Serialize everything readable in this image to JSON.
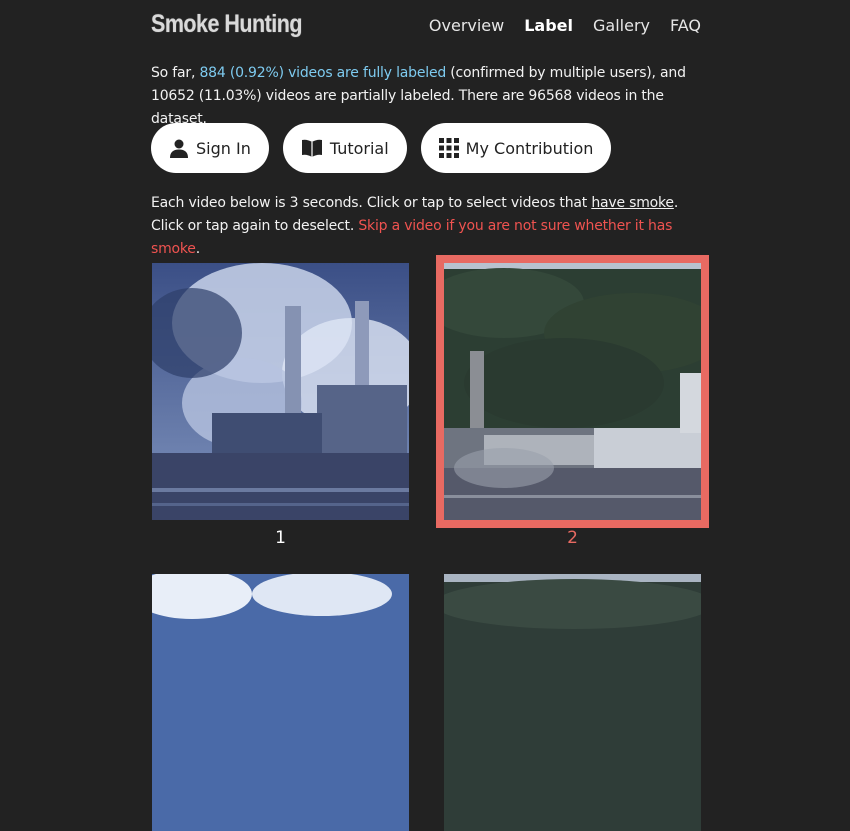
{
  "header": {
    "brand": "Smoke Hunting",
    "nav": [
      {
        "label": "Overview",
        "active": false
      },
      {
        "label": "Label",
        "active": true
      },
      {
        "label": "Gallery",
        "active": false
      },
      {
        "label": "FAQ",
        "active": false
      }
    ]
  },
  "stats": {
    "prefix": "So far, ",
    "fully_labeled": "884 (0.92%) videos are fully labeled",
    "middle": " (confirmed by multiple users), and 10652 (11.03%) videos are partially labeled. There are 96568 videos in the dataset."
  },
  "buttons": {
    "sign_in": "Sign In",
    "tutorial": "Tutorial",
    "my_contribution": "My Contribution"
  },
  "instructions": {
    "part1": "Each video below is 3 seconds. Click or tap to select videos that ",
    "underlined": "have smoke",
    "part2": ". Click or tap again to deselect. ",
    "warning": "Skip a video if you are not sure whether it has smoke",
    "end": "."
  },
  "videos": [
    {
      "number": "1",
      "selected": false
    },
    {
      "number": "2",
      "selected": true
    },
    {
      "selected": false
    },
    {
      "selected": false
    }
  ],
  "colors": {
    "background": "#222222",
    "link_highlight": "#7ecbf0",
    "warning": "#ef5350",
    "selection": "#e86a62"
  },
  "icons": [
    "user-icon",
    "book-icon",
    "grid-icon"
  ]
}
